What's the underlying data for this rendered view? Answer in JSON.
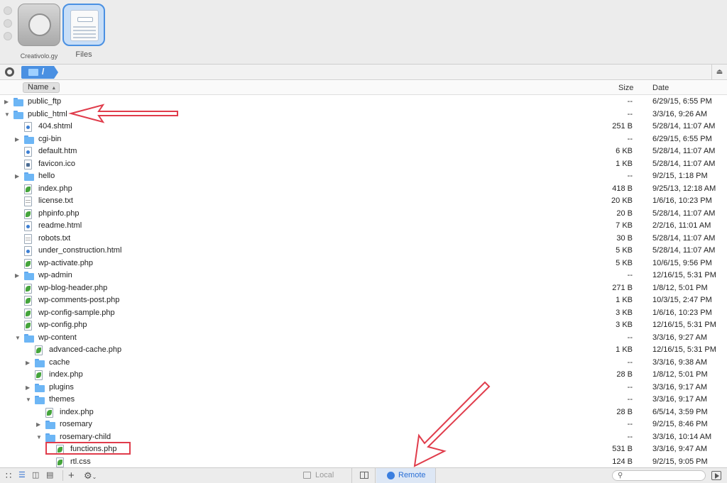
{
  "toolbar": {
    "sites": [
      {
        "label": "Creativolo.gy",
        "icon": "server-globe-icon"
      },
      {
        "label": "Files",
        "icon": "files-document-icon"
      }
    ]
  },
  "pathbar": {
    "crumb": "/"
  },
  "columns": {
    "name": "Name",
    "size": "Size",
    "date": "Date",
    "sort_indicator": "▲"
  },
  "rows": [
    {
      "name": "public_ftp",
      "type": "folder",
      "depth": 0,
      "state": "collapsed",
      "size": "--",
      "date": "6/29/15, 6:55 PM"
    },
    {
      "name": "public_html",
      "type": "folder",
      "depth": 0,
      "state": "expanded",
      "size": "--",
      "date": "3/3/16, 9:26 AM"
    },
    {
      "name": "404.shtml",
      "type": "html",
      "depth": 1,
      "state": "none",
      "size": "251 B",
      "date": "5/28/14, 11:07 AM"
    },
    {
      "name": "cgi-bin",
      "type": "folder",
      "depth": 1,
      "state": "collapsed",
      "size": "--",
      "date": "6/29/15, 6:55 PM"
    },
    {
      "name": "default.htm",
      "type": "html",
      "depth": 1,
      "state": "none",
      "size": "6 KB",
      "date": "5/28/14, 11:07 AM"
    },
    {
      "name": "favicon.ico",
      "type": "ico",
      "depth": 1,
      "state": "none",
      "size": "1 KB",
      "date": "5/28/14, 11:07 AM"
    },
    {
      "name": "hello",
      "type": "folder",
      "depth": 1,
      "state": "collapsed",
      "size": "--",
      "date": "9/2/15, 1:18 PM"
    },
    {
      "name": "index.php",
      "type": "php",
      "depth": 1,
      "state": "none",
      "size": "418 B",
      "date": "9/25/13, 12:18 AM"
    },
    {
      "name": "license.txt",
      "type": "txt",
      "depth": 1,
      "state": "none",
      "size": "20 KB",
      "date": "1/6/16, 10:23 PM"
    },
    {
      "name": "phpinfo.php",
      "type": "php",
      "depth": 1,
      "state": "none",
      "size": "20 B",
      "date": "5/28/14, 11:07 AM"
    },
    {
      "name": "readme.html",
      "type": "html",
      "depth": 1,
      "state": "none",
      "size": "7 KB",
      "date": "2/2/16, 11:01 AM"
    },
    {
      "name": "robots.txt",
      "type": "txt",
      "depth": 1,
      "state": "none",
      "size": "30 B",
      "date": "5/28/14, 11:07 AM"
    },
    {
      "name": "under_construction.html",
      "type": "html",
      "depth": 1,
      "state": "none",
      "size": "5 KB",
      "date": "5/28/14, 11:07 AM"
    },
    {
      "name": "wp-activate.php",
      "type": "php",
      "depth": 1,
      "state": "none",
      "size": "5 KB",
      "date": "10/6/15, 9:56 PM"
    },
    {
      "name": "wp-admin",
      "type": "folder",
      "depth": 1,
      "state": "collapsed",
      "size": "--",
      "date": "12/16/15, 5:31 PM"
    },
    {
      "name": "wp-blog-header.php",
      "type": "php",
      "depth": 1,
      "state": "none",
      "size": "271 B",
      "date": "1/8/12, 5:01 PM"
    },
    {
      "name": "wp-comments-post.php",
      "type": "php",
      "depth": 1,
      "state": "none",
      "size": "1 KB",
      "date": "10/3/15, 2:47 PM"
    },
    {
      "name": "wp-config-sample.php",
      "type": "php",
      "depth": 1,
      "state": "none",
      "size": "3 KB",
      "date": "1/6/16, 10:23 PM"
    },
    {
      "name": "wp-config.php",
      "type": "php",
      "depth": 1,
      "state": "none",
      "size": "3 KB",
      "date": "12/16/15, 5:31 PM"
    },
    {
      "name": "wp-content",
      "type": "folder",
      "depth": 1,
      "state": "expanded",
      "size": "--",
      "date": "3/3/16, 9:27 AM"
    },
    {
      "name": "advanced-cache.php",
      "type": "php",
      "depth": 2,
      "state": "none",
      "size": "1 KB",
      "date": "12/16/15, 5:31 PM"
    },
    {
      "name": "cache",
      "type": "folder",
      "depth": 2,
      "state": "collapsed",
      "size": "--",
      "date": "3/3/16, 9:38 AM"
    },
    {
      "name": "index.php",
      "type": "php",
      "depth": 2,
      "state": "none",
      "size": "28 B",
      "date": "1/8/12, 5:01 PM"
    },
    {
      "name": "plugins",
      "type": "folder",
      "depth": 2,
      "state": "collapsed",
      "size": "--",
      "date": "3/3/16, 9:17 AM"
    },
    {
      "name": "themes",
      "type": "folder",
      "depth": 2,
      "state": "expanded",
      "size": "--",
      "date": "3/3/16, 9:17 AM"
    },
    {
      "name": "index.php",
      "type": "php",
      "depth": 3,
      "state": "none",
      "size": "28 B",
      "date": "6/5/14, 3:59 PM"
    },
    {
      "name": "rosemary",
      "type": "folder",
      "depth": 3,
      "state": "collapsed",
      "size": "--",
      "date": "9/2/15, 8:46 PM"
    },
    {
      "name": "rosemary-child",
      "type": "folder",
      "depth": 3,
      "state": "expanded",
      "size": "--",
      "date": "3/3/16, 10:14 AM"
    },
    {
      "name": "functions.php",
      "type": "php",
      "depth": 4,
      "state": "none",
      "size": "531 B",
      "date": "3/3/16, 9:47 AM"
    },
    {
      "name": "rtl.css",
      "type": "css",
      "depth": 4,
      "state": "none",
      "size": "124 B",
      "date": "9/2/15, 9:05 PM"
    }
  ],
  "bottombar": {
    "local_label": "Local",
    "remote_label": "Remote",
    "search_placeholder": ""
  },
  "colors": {
    "accent": "#4a90e2",
    "annotation_red": "#e03c4b",
    "folder_blue": "#6db6f5"
  }
}
